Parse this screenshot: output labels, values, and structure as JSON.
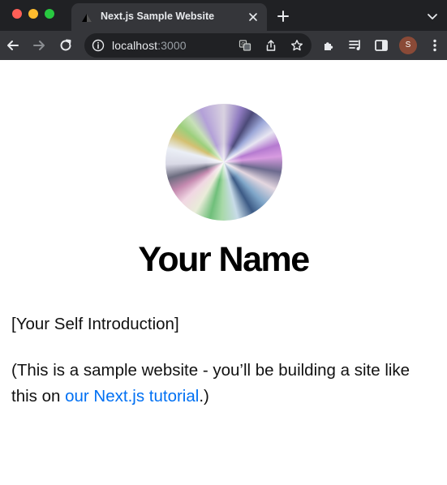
{
  "browser": {
    "tab": {
      "title": "Next.js Sample Website"
    },
    "address": {
      "host": "localhost",
      "port": ":3000"
    },
    "profile_initial": "S"
  },
  "page": {
    "name": "Your Name",
    "intro": "[Your Self Introduction]",
    "note_prefix": "(This is a sample website - you’ll be building a site like this on ",
    "note_link": "our Next.js tutorial",
    "note_suffix": ".)"
  },
  "icons": {
    "traffic_lights": [
      "close-window-icon",
      "minimize-window-icon",
      "zoom-window-icon"
    ],
    "toolbar": [
      "back-icon",
      "forward-icon",
      "reload-icon",
      "site-info-icon",
      "translate-icon",
      "share-icon",
      "bookmark-star-icon",
      "extensions-icon",
      "reading-list-icon",
      "side-panel-icon",
      "menu-dots-icon"
    ]
  },
  "colors": {
    "link": "#0070f3",
    "tabstrip": "#202124",
    "toolbar": "#35363a"
  }
}
